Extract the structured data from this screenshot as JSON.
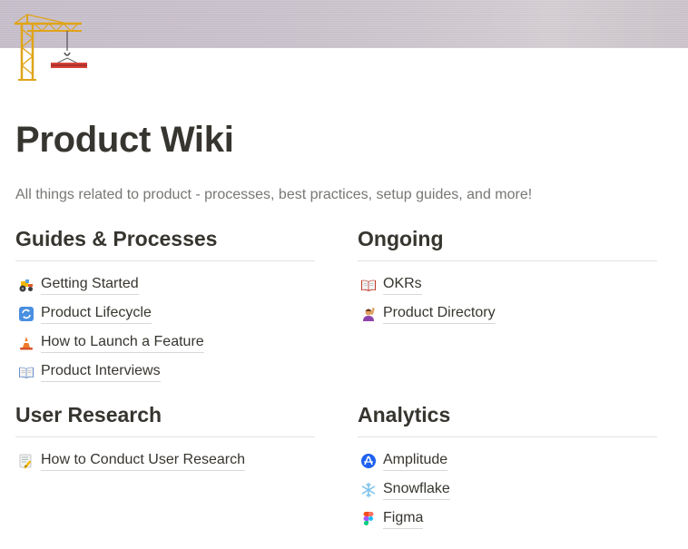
{
  "page": {
    "title": "Product Wiki",
    "subtitle": "All things related to product - processes, best practices, setup guides, and more!",
    "icon": "construction-crane-icon"
  },
  "sections": [
    {
      "heading": "Guides & Processes",
      "items": [
        {
          "label": "Getting Started",
          "icon": "tractor-icon"
        },
        {
          "label": "Product Lifecycle",
          "icon": "cycle-arrows-icon"
        },
        {
          "label": "How to Launch a Feature",
          "icon": "traffic-cone-icon"
        },
        {
          "label": "Product Interviews",
          "icon": "open-book-icon"
        }
      ]
    },
    {
      "heading": "Ongoing",
      "items": [
        {
          "label": "OKRs",
          "icon": "open-book-icon"
        },
        {
          "label": "Product Directory",
          "icon": "person-raising-hand-icon"
        }
      ]
    },
    {
      "heading": "User Research",
      "items": [
        {
          "label": "How to Conduct User Research",
          "icon": "memo-icon"
        }
      ]
    },
    {
      "heading": "Analytics",
      "items": [
        {
          "label": "Amplitude",
          "icon": "amplitude-logo-icon"
        },
        {
          "label": "Snowflake",
          "icon": "snowflake-icon"
        },
        {
          "label": "Figma",
          "icon": "figma-logo-icon"
        }
      ]
    }
  ]
}
